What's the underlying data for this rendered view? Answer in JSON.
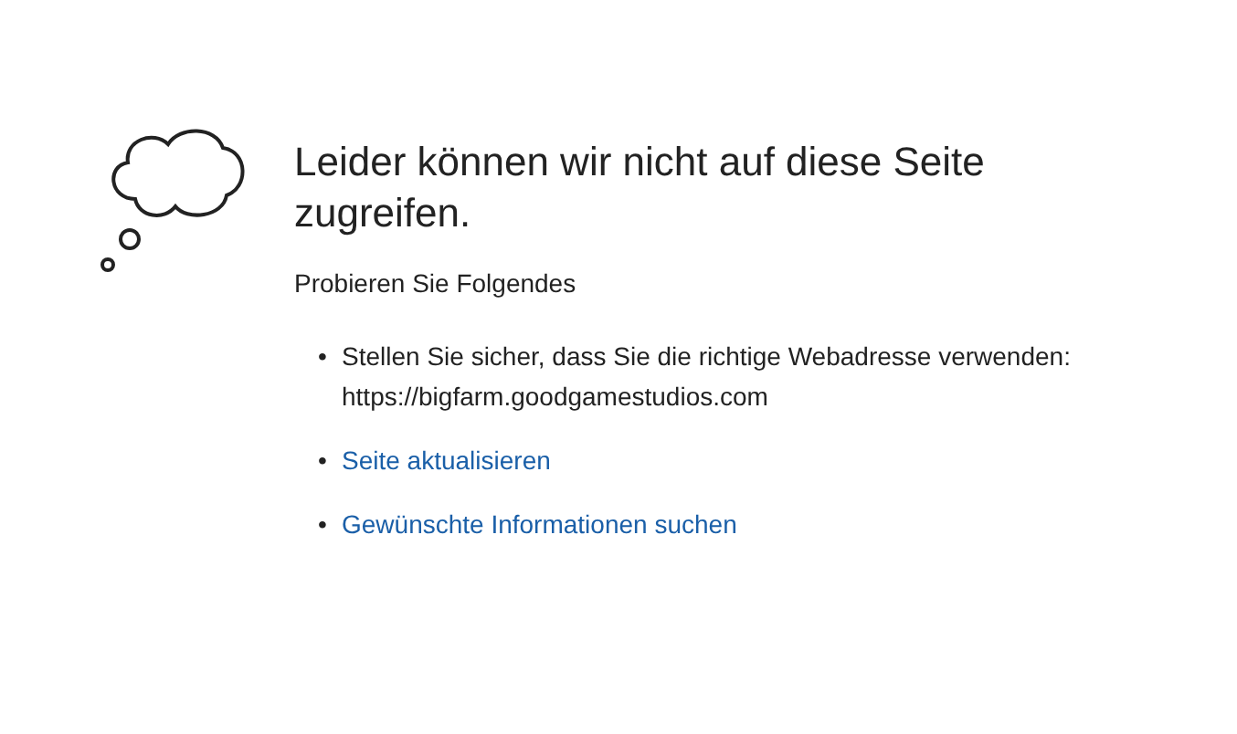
{
  "title": "Leider können wir nicht auf diese Seite zugreifen.",
  "subtitle": "Probieren Sie Folgendes",
  "suggestions": [
    {
      "kind": "text",
      "bullet": "•",
      "lines": [
        "Stellen Sie sicher, dass Sie die richtige Webadresse verwenden:",
        "https://bigfarm.goodgamestudios.com"
      ]
    },
    {
      "kind": "link",
      "bullet": "•",
      "lines": [
        "Seite aktualisieren"
      ]
    },
    {
      "kind": "link",
      "bullet": "•",
      "lines": [
        "Gewünschte Informationen suchen"
      ]
    }
  ]
}
